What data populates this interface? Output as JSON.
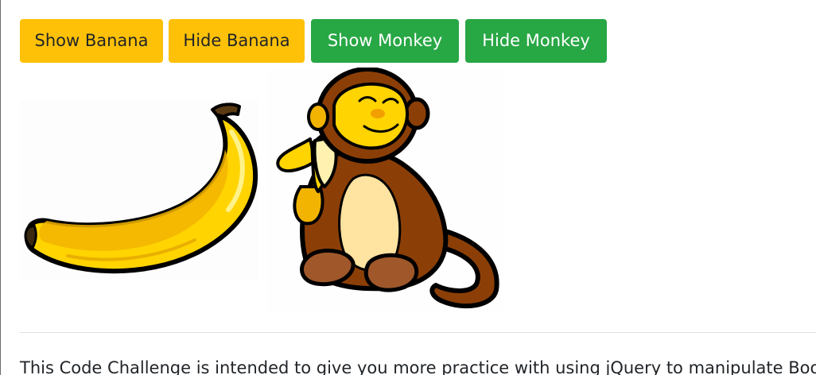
{
  "buttons": {
    "show_banana": "Show Banana",
    "hide_banana": "Hide Banana",
    "show_monkey": "Show Monkey",
    "hide_monkey": "Hide Monkey"
  },
  "colors": {
    "warning": "#ffc107",
    "success": "#28a745",
    "banana_yellow": "#ffd700",
    "monkey_brown": "#8b3a00"
  },
  "images": {
    "banana": "banana-illustration",
    "monkey": "monkey-illustration"
  },
  "content": {
    "intro": "This Code Challenge is intended to give you more practice with using jQuery to manipulate Boo"
  }
}
